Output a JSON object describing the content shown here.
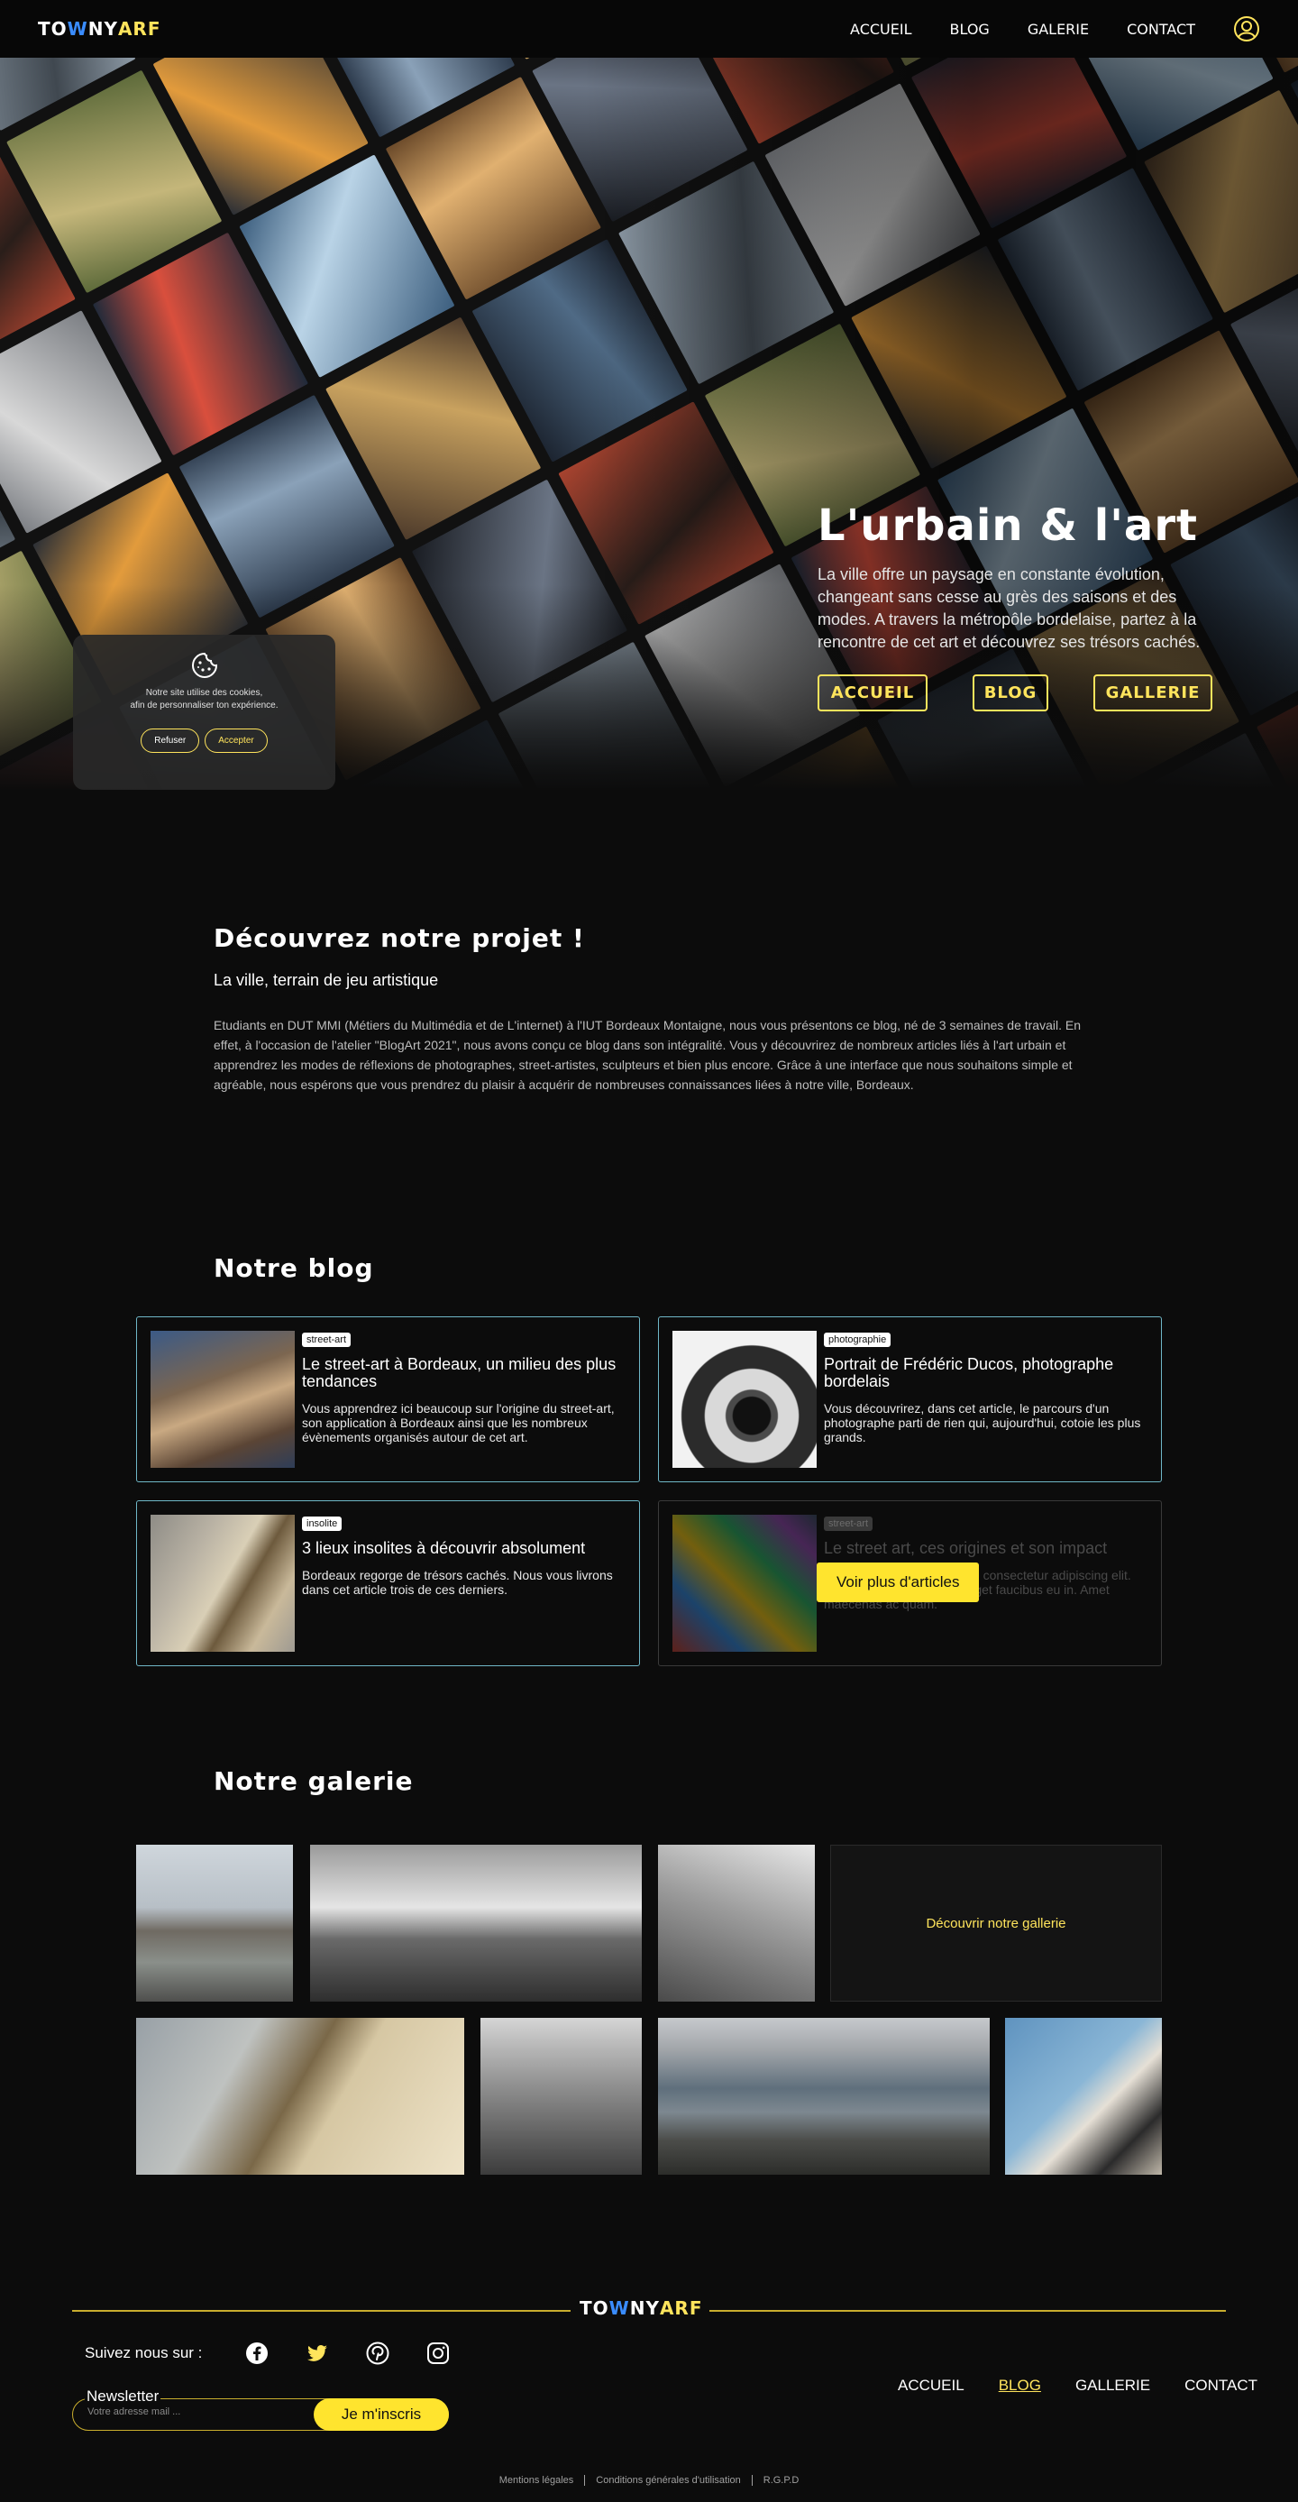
{
  "nav": {
    "logo": {
      "p1": "TO",
      "p2": "W",
      "p3": "NY",
      "p4": "ARF"
    },
    "links": [
      "ACCUEIL",
      "BLOG",
      "GALERIE",
      "CONTACT"
    ],
    "profile_icon": "user-circle-icon"
  },
  "hero": {
    "title": "L'urbain & l'art",
    "description": "La ville offre un paysage en constante évolution, changeant sans cesse au grès des saisons et des modes. A travers la métropôle bordelaise, partez à la rencontre de cet art et découvrez ses trésors cachés.",
    "buttons": [
      "ACCUEIL",
      "BLOG",
      "GALLERIE"
    ]
  },
  "cookie": {
    "icon": "cookie-icon",
    "line1": "Notre site utilise des cookies,",
    "line2": "afin de personnaliser ton expérience.",
    "refuse": "Refuser",
    "accept": "Accepter"
  },
  "project": {
    "title": "Découvrez notre projet !",
    "subtitle": "La ville, terrain de jeu artistique",
    "text": "Etudiants en DUT MMI (Métiers du Multimédia et de L'internet) à l'IUT Bordeaux Montaigne, nous vous présentons ce blog, né de 3 semaines de travail. En effet, à l'occasion de l'atelier \"BlogArt 2021\", nous avons conçu ce blog dans son intégralité. Vous y découvrirez de nombreux articles liés à l'art urbain et apprendrez les modes de réflexions de photographes, street-artistes, sculpteurs et bien plus encore. Grâce à une interface que nous souhaitons simple et agréable, nous espérons que vous prendrez du plaisir à acquérir de nombreuses connaissances liées à notre ville, Bordeaux."
  },
  "blog": {
    "title": "Notre blog",
    "cards": [
      {
        "badge": "street-art",
        "title": "Le street-art à Bordeaux, un milieu des plus tendances",
        "text": "Vous apprendrez ici beaucoup sur l'origine du street-art, son application à Bordeaux ainsi que les nombreux évènements organisés autour de cet art."
      },
      {
        "badge": "photographie",
        "title": "Portrait de Frédéric Ducos, photographe bordelais",
        "text": "Vous découvrirez, dans cet article, le parcours d'un photographe parti de rien  qui, aujourd'hui, cotoie les plus grands."
      },
      {
        "badge": "insolite",
        "title": "3 lieux insolites à découvrir absolument",
        "text": "Bordeaux regorge de trésors cachés. Nous vous livrons dans cet article trois de ces derniers."
      },
      {
        "badge": "street-art",
        "title": "Le street art, ces origines et son impact",
        "text": "Lorem ipsum dolor sit amet, consectetur adipiscing elit. Netus non eget sed diam eget faucibus eu in. Amet maecenas ac quam."
      }
    ],
    "more_button": "Voir plus d'articles"
  },
  "gallery": {
    "title": "Notre galerie",
    "cta": "Découvrir notre gallerie"
  },
  "footer": {
    "follow": "Suivez nous sur :",
    "socials": [
      "facebook-icon",
      "twitter-icon",
      "pinterest-icon",
      "instagram-icon"
    ],
    "newsletter_label": "Newsletter",
    "newsletter_placeholder": "Votre adresse mail ...",
    "newsletter_button": "Je m'inscris",
    "links": [
      "ACCUEIL",
      "BLOG",
      "GALLERIE",
      "CONTACT"
    ],
    "legal": [
      "Mentions légales",
      "Conditions générales d'utilisation",
      "R.G.P.D"
    ]
  },
  "colors": {
    "accent": "#ffe45c",
    "card_border": "#6fb7c7",
    "background": "#0c0c0c"
  }
}
